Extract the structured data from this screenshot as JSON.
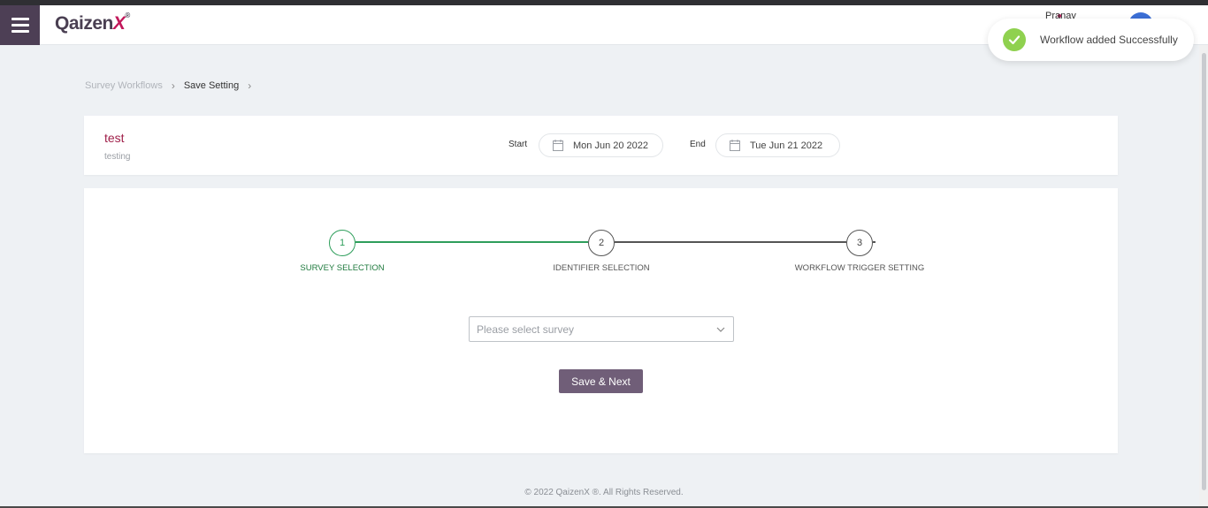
{
  "header": {
    "logo_main": "Qaizen",
    "logo_x": "X",
    "logo_reg": "®",
    "user_name": "Pranav"
  },
  "toast": {
    "message": "Workflow added Successfully",
    "icon": "check-circle-icon",
    "color": "#8fd14f"
  },
  "breadcrumb": {
    "items": [
      "Survey Workflows",
      "Save Setting"
    ],
    "separator": "›"
  },
  "workflow": {
    "name": "test",
    "description": "testing",
    "start_label": "Start",
    "start_date": "Mon Jun 20 2022",
    "end_label": "End",
    "end_date": "Tue Jun 21 2022"
  },
  "stepper": {
    "steps": [
      {
        "number": "1",
        "label": "SURVEY SELECTION",
        "active": true
      },
      {
        "number": "2",
        "label": "IDENTIFIER SELECTION",
        "active": false
      },
      {
        "number": "3",
        "label": "WORKFLOW TRIGGER SETTING",
        "active": false
      }
    ],
    "active_color": "#2e9e5b"
  },
  "form": {
    "survey_placeholder": "Please select survey",
    "save_next_label": "Save & Next"
  },
  "footer": {
    "text": "© 2022 QaizenX ®. All Rights Reserved."
  },
  "colors": {
    "brand": "#4d3f55",
    "accent": "#c2185b",
    "button": "#705e78"
  }
}
